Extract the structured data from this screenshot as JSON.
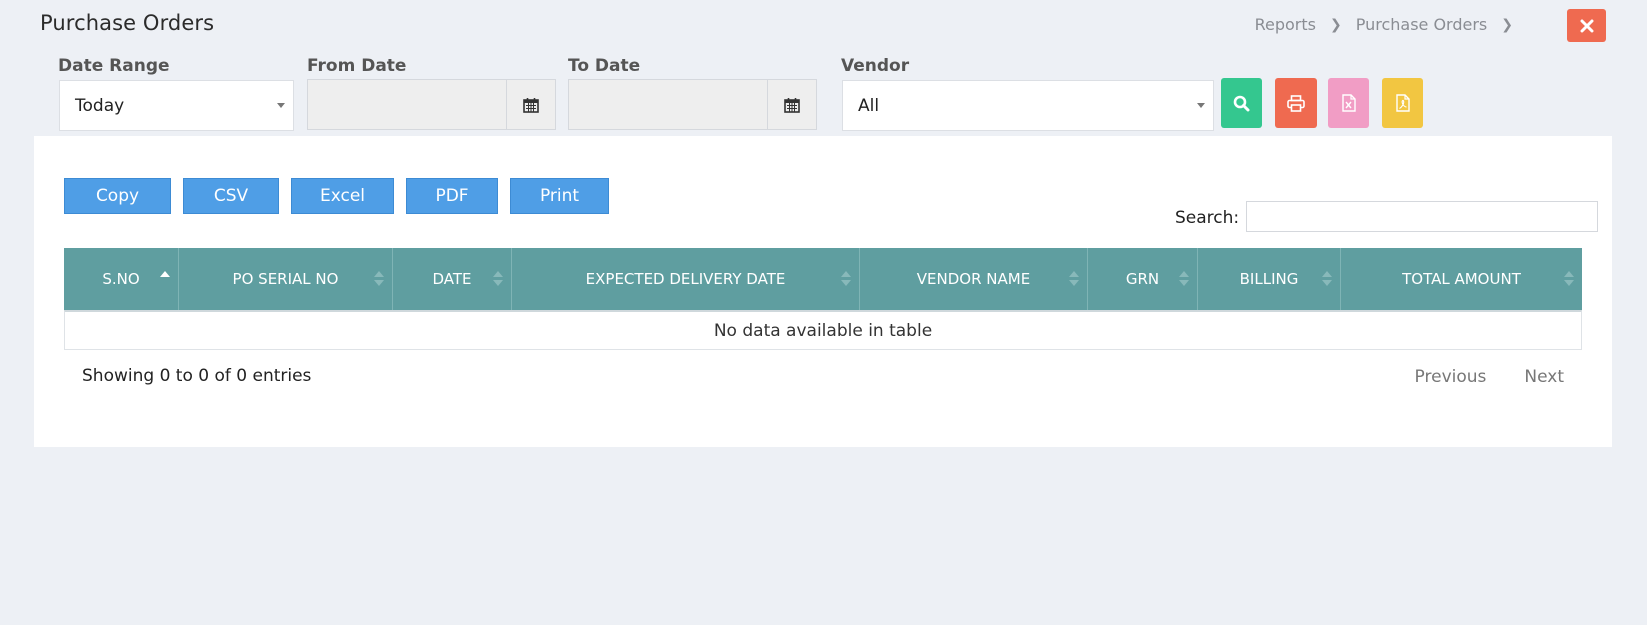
{
  "page": {
    "title": "Purchase Orders"
  },
  "breadcrumb": {
    "items": [
      "Reports",
      "Purchase Orders"
    ]
  },
  "filters": {
    "date_range": {
      "label": "Date Range",
      "value": "Today"
    },
    "from_date": {
      "label": "From Date",
      "value": ""
    },
    "to_date": {
      "label": "To Date",
      "value": ""
    },
    "vendor": {
      "label": "Vendor",
      "value": "All"
    }
  },
  "actions": {
    "search_color": "#34c78f",
    "print_color": "#ef6a50",
    "excel_color": "#f19dc5",
    "pdf_color": "#f2c641",
    "close_color": "#ef6a50"
  },
  "toolbar": {
    "buttons": [
      "Copy",
      "CSV",
      "Excel",
      "PDF",
      "Print"
    ],
    "search_label": "Search:",
    "search_value": ""
  },
  "table": {
    "header_color": "#5f9ea0",
    "columns": [
      "S.NO",
      "PO SERIAL NO",
      "DATE",
      "EXPECTED DELIVERY DATE",
      "VENDOR NAME",
      "GRN",
      "BILLING",
      "TOTAL AMOUNT"
    ],
    "empty_message": "No data available in table",
    "info": "Showing 0 to 0 of 0 entries",
    "pagination": {
      "previous": "Previous",
      "next": "Next"
    }
  },
  "icons": {
    "close": "close-icon",
    "calendar": "calendar-icon",
    "search": "search-icon",
    "print": "print-icon",
    "excel": "excel-file-icon",
    "pdf": "pdf-file-icon",
    "sort": "sort-icon"
  }
}
